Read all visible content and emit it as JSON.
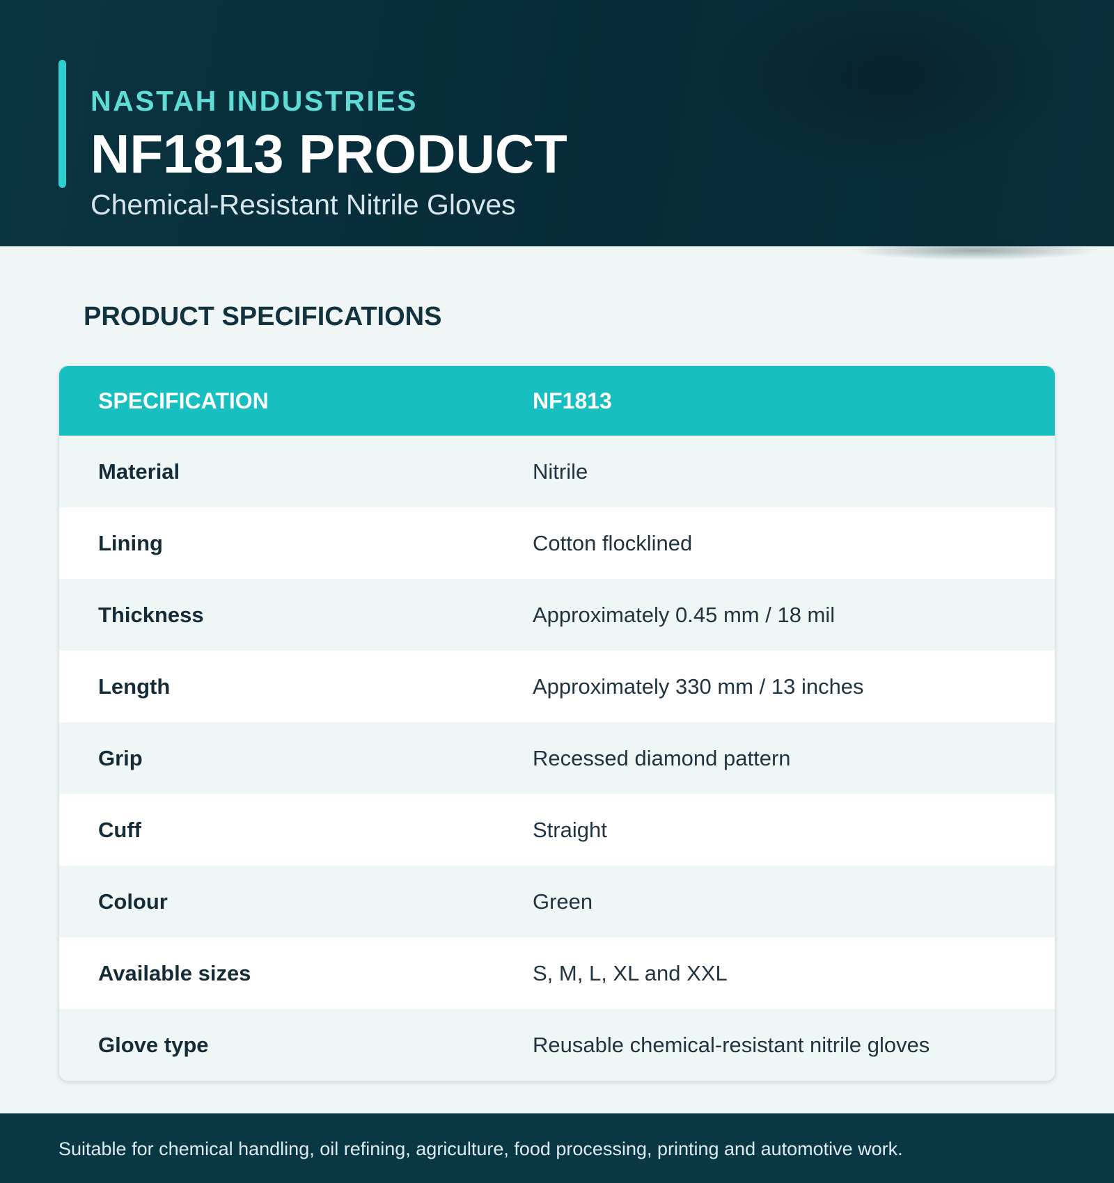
{
  "header": {
    "company": "NASTAH INDUSTRIES",
    "title": "NF1813 PRODUCT",
    "subtitle": "Chemical-Resistant Nitrile Gloves"
  },
  "section": {
    "title": "PRODUCT SPECIFICATIONS"
  },
  "table": {
    "columns": [
      "SPECIFICATION",
      "NF1813"
    ],
    "rows": [
      {
        "label": "Material",
        "value": "Nitrile"
      },
      {
        "label": "Lining",
        "value": "Cotton flocklined"
      },
      {
        "label": "Thickness",
        "value": "Approximately 0.45 mm / 18 mil"
      },
      {
        "label": "Length",
        "value": "Approximately 330 mm / 13 inches"
      },
      {
        "label": "Grip",
        "value": "Recessed diamond pattern"
      },
      {
        "label": "Cuff",
        "value": "Straight"
      },
      {
        "label": "Colour",
        "value": "Green"
      },
      {
        "label": "Available sizes",
        "value": "S, M, L, XL and XXL"
      },
      {
        "label": "Glove type",
        "value": "Reusable chemical-resistant nitrile gloves"
      }
    ]
  },
  "footer": {
    "text": "Suitable for chemical handling, oil refining, agriculture, food processing, printing and automotive work."
  },
  "colors": {
    "header_bg": "#072b38",
    "accent": "#2dd0cc",
    "table_header_bg": "#17bfc0",
    "row_alt_bg": "#eef6f6",
    "footer_bg": "#093844"
  }
}
